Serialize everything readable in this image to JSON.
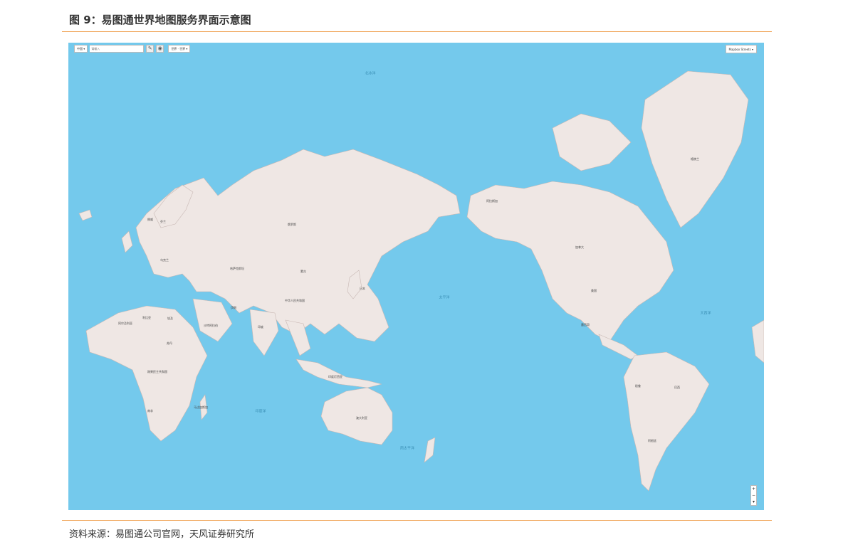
{
  "figure": {
    "title": "图 9：易图通世界地图服务界面示意图",
    "source": "资料来源：易图通公司官网，天风证券研究所"
  },
  "map": {
    "colors": {
      "ocean": "#74c9ec",
      "land": "#efe7e4",
      "border": "#c8b8b4"
    },
    "toolbar": {
      "region_select": "中国 ▾",
      "search_placeholder": "请输入",
      "layer_icon": "layer-icon",
      "locate_icon": "locate-icon",
      "world_select": "世界 · 世界 ▾"
    },
    "basemap_select": "Mapbox Streets ▾",
    "zoom": {
      "plus": "+",
      "minus": "−",
      "reset": "▾"
    },
    "country_labels": [
      {
        "name": "俄罗斯"
      },
      {
        "name": "哈萨克斯坦"
      },
      {
        "name": "蒙古"
      },
      {
        "name": "中华人民共和国"
      },
      {
        "name": "印度"
      },
      {
        "name": "伊朗"
      },
      {
        "name": "沙特阿拉伯"
      },
      {
        "name": "加拿大"
      },
      {
        "name": "美国"
      },
      {
        "name": "墨西哥"
      },
      {
        "name": "巴西"
      },
      {
        "name": "秘鲁"
      },
      {
        "name": "阿根廷"
      },
      {
        "name": "澳大利亚"
      },
      {
        "name": "格陵兰"
      },
      {
        "name": "阿尔及利亚"
      },
      {
        "name": "利比亚"
      },
      {
        "name": "埃及"
      },
      {
        "name": "苏丹"
      },
      {
        "name": "刚果民主共和国"
      },
      {
        "name": "南非"
      },
      {
        "name": "马达加斯加"
      },
      {
        "name": "印度尼西亚"
      },
      {
        "name": "日本"
      },
      {
        "name": "阿拉斯加"
      },
      {
        "name": "乌克兰"
      },
      {
        "name": "芬兰"
      },
      {
        "name": "挪威"
      }
    ],
    "ocean_labels": [
      {
        "name": "北冰洋"
      },
      {
        "name": "太平洋"
      },
      {
        "name": "大西洋"
      },
      {
        "name": "印度洋"
      },
      {
        "name": "南太平洋"
      }
    ]
  }
}
